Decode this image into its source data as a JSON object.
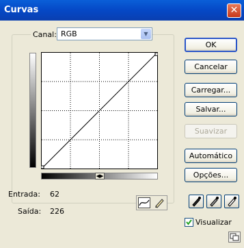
{
  "window": {
    "title": "Curvas"
  },
  "channel": {
    "label": "Canal:",
    "value": "RGB"
  },
  "readout": {
    "input_label": "Entrada:",
    "input_value": "62",
    "output_label": "Saída:",
    "output_value": "226"
  },
  "buttons": {
    "ok": "OK",
    "cancel": "Cancelar",
    "load": "Carregar...",
    "save": "Salvar...",
    "smooth": "Suavizar",
    "auto": "Automático",
    "options": "Opções..."
  },
  "preview": {
    "label": "Visualizar",
    "checked": true
  },
  "icons": {
    "close": "close-icon",
    "dropdown": "chevron-down-icon",
    "curve_tool": "curve-tool-icon",
    "pencil_tool": "pencil-icon",
    "black_eyedropper": "eyedropper-black-icon",
    "gray_eyedropper": "eyedropper-gray-icon",
    "white_eyedropper": "eyedropper-white-icon",
    "expand": "expand-icon"
  },
  "colors": {
    "titlebar": "#0548c6",
    "close": "#c9381a",
    "dialog_bg": "#ece9d8"
  }
}
